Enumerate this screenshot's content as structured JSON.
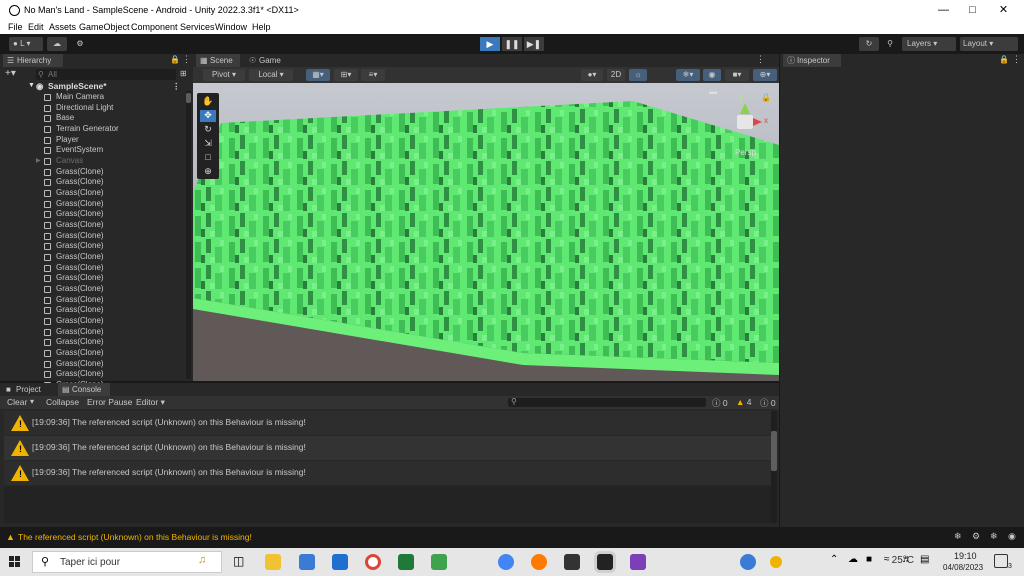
{
  "window": {
    "title": "No Man's Land - SampleScene - Android - Unity 2022.3.3f1* <DX11>"
  },
  "menu": [
    "File",
    "Edit",
    "Assets",
    "GameObject",
    "Component",
    "Services",
    "Window",
    "Help"
  ],
  "toolbar": {
    "account": "L",
    "layers": "Layers",
    "layout": "Layout"
  },
  "hierarchy": {
    "tab": "Hierarchy",
    "search_placeholder": "All",
    "scene": "SampleScene*",
    "items": [
      "Main Camera",
      "Directional Light",
      "Base",
      "Terrain Generator",
      "Player",
      "EventSystem",
      "Canvas",
      "Grass(Clone)",
      "Grass(Clone)",
      "Grass(Clone)",
      "Grass(Clone)",
      "Grass(Clone)",
      "Grass(Clone)",
      "Grass(Clone)",
      "Grass(Clone)",
      "Grass(Clone)",
      "Grass(Clone)",
      "Grass(Clone)",
      "Grass(Clone)",
      "Grass(Clone)",
      "Grass(Clone)",
      "Grass(Clone)",
      "Grass(Clone)",
      "Grass(Clone)",
      "Grass(Clone)",
      "Grass(Clone)",
      "Grass(Clone)",
      "Grass(Clone)"
    ]
  },
  "scene": {
    "tab_scene": "Scene",
    "tab_game": "Game",
    "pivot": "Pivot",
    "local": "Local",
    "mode_2d": "2D",
    "persp": "Persp",
    "gizmo_y": "y",
    "gizmo_x": "x"
  },
  "inspector": {
    "tab": "Inspector"
  },
  "console": {
    "tab_project": "Project",
    "tab_console": "Console",
    "clear": "Clear",
    "collapse": "Collapse",
    "error_pause": "Error Pause",
    "editor": "Editor",
    "count_info": "0",
    "count_warn": "4",
    "count_err": "0",
    "logs": [
      "[19:09:36] The referenced script (Unknown) on this Behaviour is missing!",
      "[19:09:36] The referenced script (Unknown) on this Behaviour is missing!",
      "[19:09:36] The referenced script (Unknown) on this Behaviour is missing!"
    ]
  },
  "status": {
    "message": "The referenced script (Unknown) on this Behaviour is missing!"
  },
  "taskbar": {
    "search_placeholder": "Taper ici pour",
    "temperature": "25°C",
    "time": "19:10",
    "date": "04/08/2023",
    "notifications": "3"
  },
  "colors": {
    "grass": "#5fe872",
    "grass_dark": "#2f8f42",
    "accent": "#4e8fd8",
    "warn": "#f0b400"
  }
}
